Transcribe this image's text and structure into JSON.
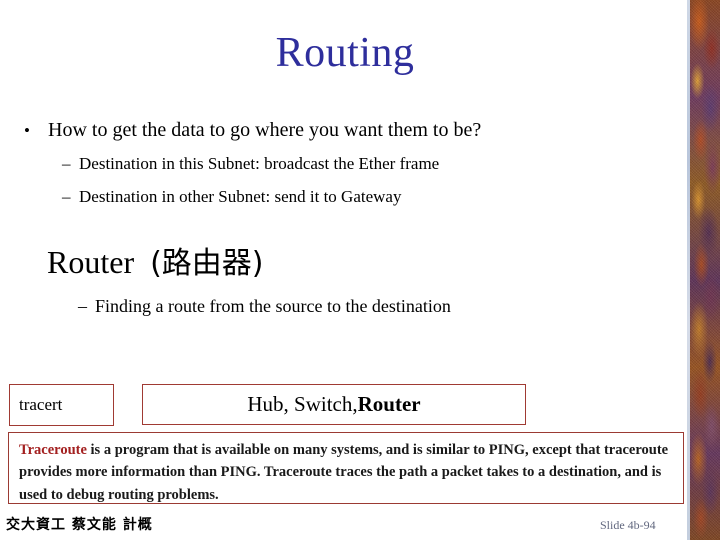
{
  "slide": {
    "title": "Routing",
    "title_color": "#2e2e9c",
    "background_color": "#ffffff"
  },
  "bullets": {
    "level1_marker": "•",
    "level2_marker": "–",
    "main": "How to get the data to go where you want them to be?",
    "sub1": "Destination in this Subnet: broadcast the Ether frame",
    "sub2": "Destination in other Subnet: send it to Gateway"
  },
  "router_section": {
    "heading_latin": "Router",
    "heading_cjk": "(路由器)",
    "sub": "Finding a route from the source to the destination"
  },
  "boxes": {
    "border_color": "#a03a33",
    "tracert_label": "tracert",
    "devices_prefix": "Hub, Switch, ",
    "devices_emphasis": "Router"
  },
  "traceroute_note": {
    "border_color": "#9b3a33",
    "highlight_word": "Traceroute",
    "highlight_color": "#a32020",
    "line1_rest": " is a program that is available on many systems, and is similar to PING,",
    "line2": "except that traceroute provides more information than PING. Traceroute traces the",
    "line3": "path a packet takes to a destination, and is used to debug routing problems."
  },
  "footer": {
    "left": "交大資工 蔡文能 計概",
    "right": "Slide 4b-94",
    "right_color": "#62687f"
  }
}
